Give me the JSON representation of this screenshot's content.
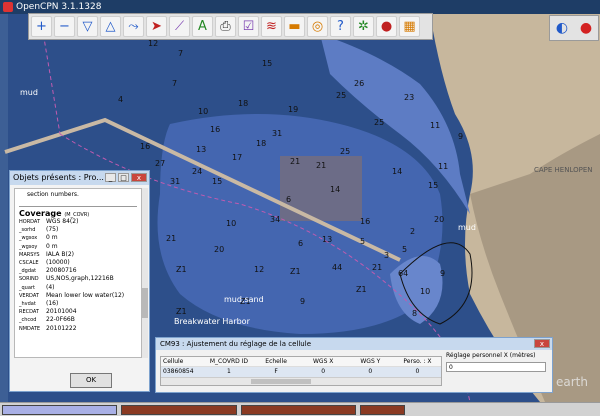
{
  "window": {
    "title": "OpenCPN 3.1.1328"
  },
  "toolbar": {
    "buttons": [
      {
        "name": "zoom-in",
        "glyph": "+"
      },
      {
        "name": "zoom-out",
        "glyph": "−"
      },
      {
        "name": "scale-in",
        "glyph": "▽"
      },
      {
        "name": "scale-out",
        "glyph": "△"
      },
      {
        "name": "route",
        "glyph": "⤳"
      },
      {
        "name": "own-ship",
        "glyph": "➤"
      },
      {
        "name": "measure",
        "glyph": "⟋"
      },
      {
        "name": "text",
        "glyph": "A"
      },
      {
        "name": "print",
        "glyph": "⎙"
      },
      {
        "name": "route-manager",
        "glyph": "☑"
      },
      {
        "name": "track",
        "glyph": "≋"
      },
      {
        "name": "color-scheme",
        "glyph": "▬"
      },
      {
        "name": "mob",
        "glyph": "◎"
      },
      {
        "name": "help",
        "glyph": "?"
      },
      {
        "name": "plugin-1",
        "glyph": "✲"
      },
      {
        "name": "plugin-2",
        "glyph": "●"
      },
      {
        "name": "plugin-3",
        "glyph": "▦"
      }
    ]
  },
  "compass": {
    "north_glyph": "◐",
    "course_glyph": "●"
  },
  "map": {
    "labels": [
      {
        "text": "mud"
      },
      {
        "text": "mud"
      },
      {
        "text": "mud"
      },
      {
        "text": "mud,sand"
      },
      {
        "text": "Breakwater Harbor"
      },
      {
        "text": "CAPE HENLOPEN"
      },
      {
        "text": "earth"
      }
    ],
    "soundings": [
      "16",
      "12",
      "7",
      "4",
      "7",
      "10",
      "15",
      "18",
      "19",
      "25",
      "26",
      "23",
      "11",
      "16",
      "17",
      "18",
      "21",
      "21",
      "25",
      "14",
      "15",
      "24",
      "31",
      "27",
      "16",
      "18",
      "20",
      "9",
      "3",
      "5",
      "2",
      "13",
      "20",
      "21",
      "64",
      "10",
      "9",
      "5",
      "16",
      "Z1",
      "Z1",
      "Z1",
      "Z1",
      "Z1",
      "Z1",
      "21",
      "20",
      "10",
      "34",
      "15",
      "31",
      "13",
      "25",
      "11",
      "14",
      "6",
      "6",
      "12",
      "9",
      "44",
      "8"
    ]
  },
  "objects_window": {
    "title": "Objets présents : Pro...",
    "section_text": "section numbers.",
    "heading": "Coverage",
    "heading_code": "(M_COVR)",
    "attributes": [
      {
        "key": "HORDAT",
        "value": "WGS 84(2)"
      },
      {
        "key": "_sorhd",
        "value": "(75)"
      },
      {
        "key": "_wgsox",
        "value": "0 m"
      },
      {
        "key": "_wgsoy",
        "value": "0 m"
      },
      {
        "key": "MARSYS",
        "value": "IALA B(2)"
      },
      {
        "key": "CSCALE",
        "value": "(10000)"
      },
      {
        "key": "_dgdat",
        "value": "20080716"
      },
      {
        "key": "SORIND",
        "value": "US,NOS,graph,12216B"
      },
      {
        "key": "_quart",
        "value": "(4)"
      },
      {
        "key": "VERDAT",
        "value": "Mean lower low water(12)"
      },
      {
        "key": "_hvdat",
        "value": "(16)"
      },
      {
        "key": "RECDAT",
        "value": "20101004"
      },
      {
        "key": "_chcod",
        "value": "22-0F66B"
      },
      {
        "key": "NMDATE",
        "value": "20101222"
      }
    ],
    "ok_label": "OK"
  },
  "cm93_window": {
    "title": "CM93 : Ajustement du réglage de la cellule",
    "columns": [
      "Cellule",
      "M_COVRD ID",
      "Echelle",
      "WGS X",
      "WGS Y",
      "Perso. : X"
    ],
    "rows": [
      [
        "03860854",
        "1",
        "F",
        "0",
        "0",
        "0"
      ]
    ],
    "side_label": "Réglage personnel X (mètres)",
    "side_value": "0"
  },
  "colors": {
    "deep_water": "#2d4f8a",
    "shoal_water": "#4466b0",
    "shallow_water": "#5d7cc4",
    "land": "#b8a58b",
    "status_blue": "#a9b0e6",
    "status_red": "#8a3a22"
  }
}
